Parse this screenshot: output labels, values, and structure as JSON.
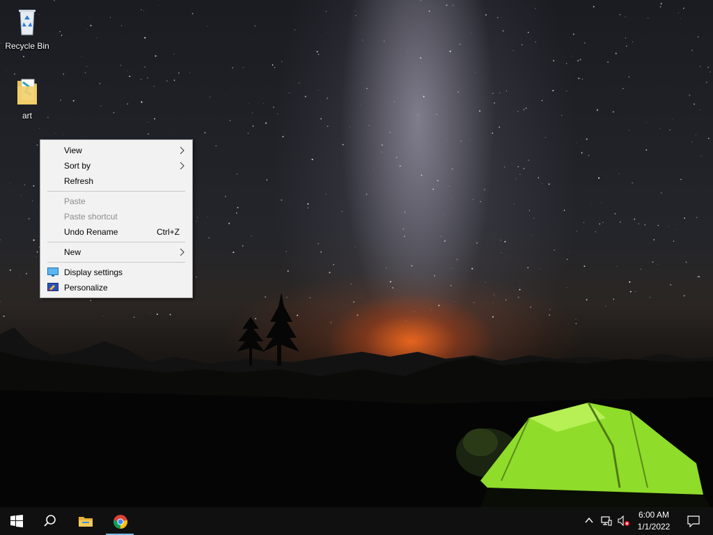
{
  "desktop": {
    "icons": [
      {
        "label": "Recycle Bin",
        "icon": "recycle-bin-icon"
      },
      {
        "label": "art",
        "icon": "folder-icon"
      }
    ]
  },
  "context_menu": {
    "items": [
      {
        "label": "View",
        "submenu": true
      },
      {
        "label": "Sort by",
        "submenu": true
      },
      {
        "label": "Refresh"
      },
      {
        "label": "Paste",
        "disabled": true
      },
      {
        "label": "Paste shortcut",
        "disabled": true
      },
      {
        "label": "Undo Rename",
        "shortcut": "Ctrl+Z"
      },
      {
        "label": "New",
        "submenu": true
      },
      {
        "label": "Display settings",
        "icon": "display-settings-icon"
      },
      {
        "label": "Personalize",
        "icon": "personalize-icon"
      }
    ]
  },
  "taskbar": {
    "pinned": [
      {
        "name": "start",
        "icon": "windows-logo-icon"
      },
      {
        "name": "search",
        "icon": "search-icon"
      },
      {
        "name": "file-explorer",
        "icon": "folder-icon"
      },
      {
        "name": "chrome",
        "icon": "chrome-icon",
        "active": true
      }
    ],
    "tray": {
      "icons": [
        "chevron-up-icon",
        "network-icon",
        "volume-muted-icon"
      ],
      "time": "6:00 AM",
      "date": "1/1/2022"
    }
  },
  "colors": {
    "taskbar_bg": "#101010",
    "menu_bg": "#f2f2f2",
    "active_indicator": "#76b9ed",
    "tent_green": "#8fdc2a"
  }
}
